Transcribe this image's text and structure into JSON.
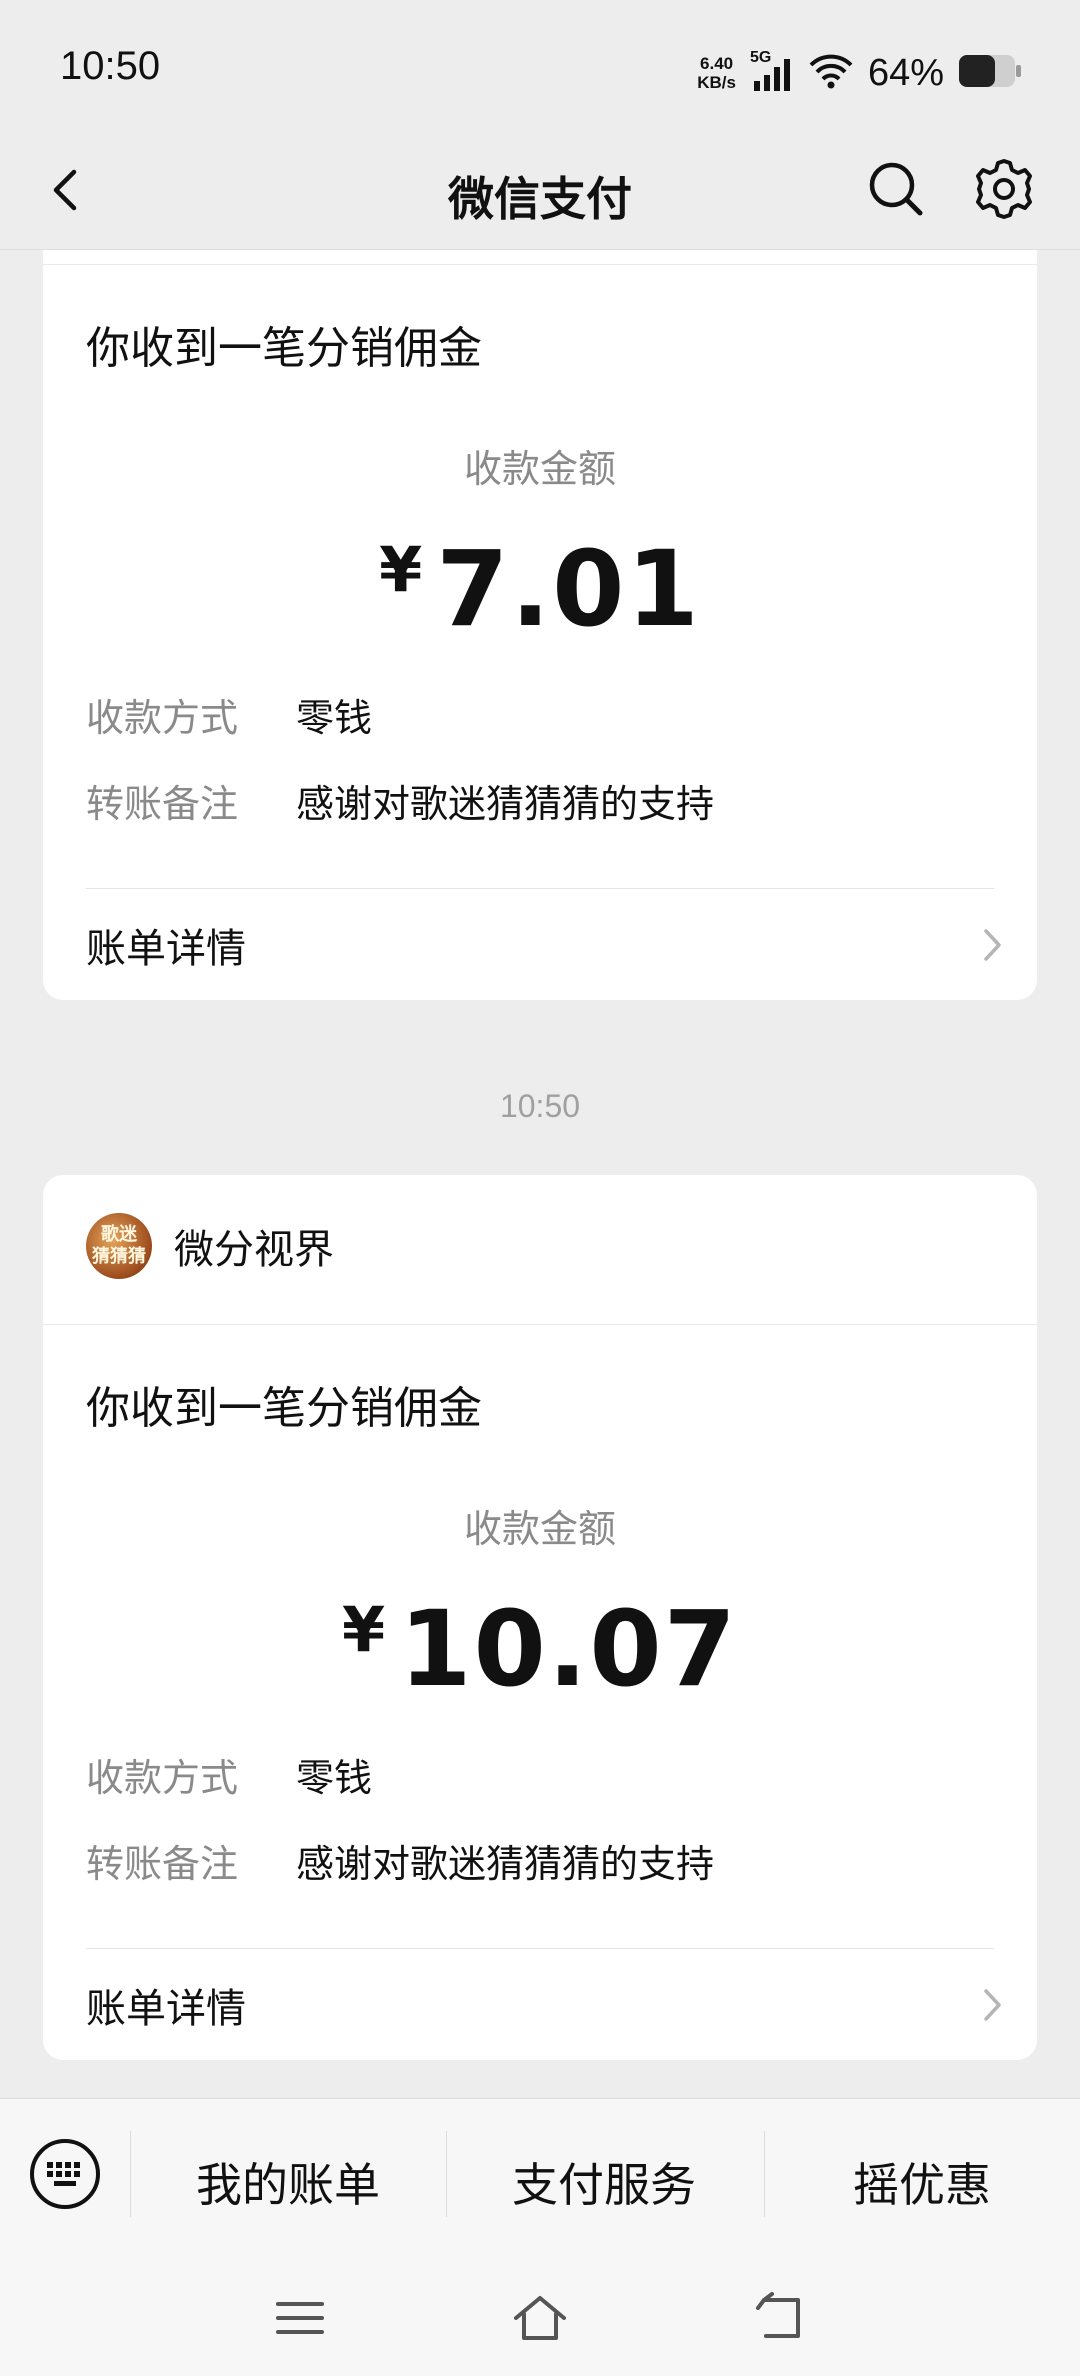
{
  "status_bar": {
    "time": "10:50",
    "net_speed_value": "6.40",
    "net_speed_unit": "KB/s",
    "network": "5G",
    "battery": "64%"
  },
  "header": {
    "title": "微信支付",
    "icons": [
      "back-icon",
      "search-icon",
      "gear-icon"
    ]
  },
  "cards": [
    {
      "notice_title": "你收到一笔分销佣金",
      "amount_label": "收款金额",
      "currency": "¥",
      "amount": "7.01",
      "method_key": "收款方式",
      "method_value": "零钱",
      "note_key": "转账备注",
      "note_value": "感谢对歌迷猜猜猜的支持",
      "detail_label": "账单详情"
    },
    {
      "merchant_name": "微分视界",
      "avatar_text": "歌迷\n猜猜猜",
      "notice_title": "你收到一笔分销佣金",
      "amount_label": "收款金额",
      "currency": "¥",
      "amount": "10.07",
      "method_key": "收款方式",
      "method_value": "零钱",
      "note_key": "转账备注",
      "note_value": "感谢对歌迷猜猜猜的支持",
      "detail_label": "账单详情"
    }
  ],
  "timestamp": "10:50",
  "bottom_menu": {
    "items": [
      "我的账单",
      "支付服务",
      "摇优惠"
    ]
  }
}
